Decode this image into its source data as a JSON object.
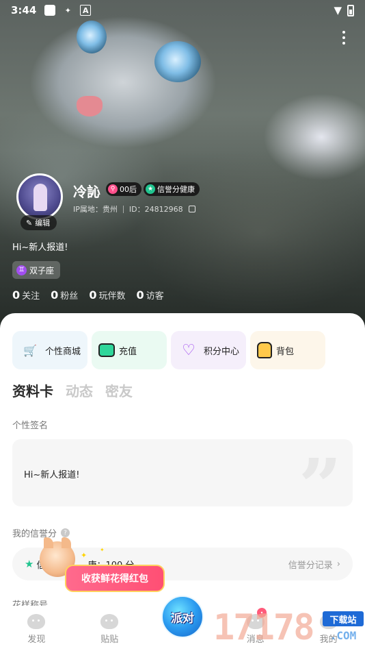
{
  "status_bar": {
    "time": "3:44",
    "keyboard_label": "A"
  },
  "profile": {
    "nickname": "冷訫",
    "badges": [
      {
        "label": "00后",
        "icon": "search-icon",
        "color": "#ff4f8b"
      },
      {
        "label": "信誉分健康",
        "icon": "star-icon",
        "color": "#21c48f"
      }
    ],
    "ip_location": "IP属地：贵州",
    "user_id": "ID：24812968",
    "edit_label": "编辑",
    "bio": "Hi~新人报道!",
    "zodiac": "双子座",
    "stats": [
      {
        "value": "0",
        "label": "关注"
      },
      {
        "value": "0",
        "label": "粉丝"
      },
      {
        "value": "0",
        "label": "玩伴数"
      },
      {
        "value": "0",
        "label": "访客"
      }
    ]
  },
  "shortcuts": [
    {
      "label": "个性商城",
      "icon": "cart-icon",
      "bg": "#eef6fb"
    },
    {
      "label": "充值",
      "icon": "wallet-icon",
      "bg": "#eafaf2"
    },
    {
      "label": "积分中心",
      "icon": "diamond-icon",
      "bg": "#f5effb"
    },
    {
      "label": "背包",
      "icon": "backpack-icon",
      "bg": "#fdf6ea"
    }
  ],
  "tabs": [
    {
      "label": "资料卡",
      "active": true
    },
    {
      "label": "动态",
      "active": false
    },
    {
      "label": "密友",
      "active": false
    }
  ],
  "signature": {
    "title": "个性签名",
    "text": "Hi~新人报道!"
  },
  "credit": {
    "title": "我的信誉分",
    "text_visible": "信",
    "text_tail": "康：100 分",
    "record_link": "信誉分记录"
  },
  "section3_title": "花样称号",
  "promo": {
    "label": "收获鲜花得红包"
  },
  "bottom_nav": [
    {
      "label": "发现"
    },
    {
      "label": "贴贴"
    },
    {
      "label": "派对"
    },
    {
      "label": "消息"
    },
    {
      "label": "我的"
    }
  ],
  "watermark": {
    "main": "17178",
    "side_top": "下载站",
    "side_bottom": ".COM"
  }
}
